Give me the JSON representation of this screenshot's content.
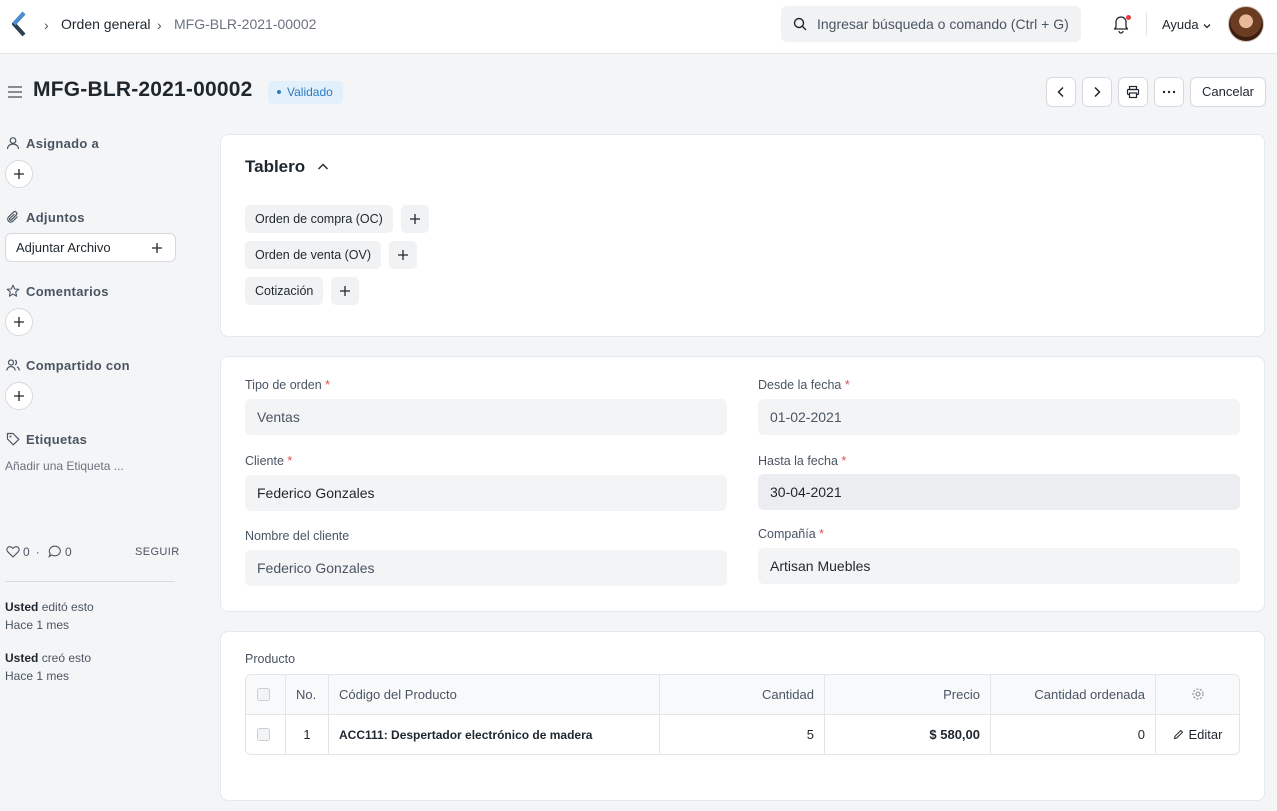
{
  "navbar": {
    "breadcrumb": [
      "Orden general",
      "MFG-BLR-2021-00002"
    ],
    "search_placeholder": "Ingresar búsqueda o comando (Ctrl + G)",
    "help_label": "Ayuda"
  },
  "header": {
    "title": "MFG-BLR-2021-00002",
    "status": "Validado",
    "status_color": "#2d7bc0",
    "cancel_label": "Cancelar"
  },
  "sidebar": {
    "assigned_label": "Asignado a",
    "attachments_label": "Adjuntos",
    "attach_button": "Adjuntar Archivo",
    "comments_label": "Comentarios",
    "shared_label": "Compartido con",
    "tags_label": "Etiquetas",
    "tag_placeholder": "Añadir una Etiqueta ...",
    "likes": "0",
    "comments_count": "0",
    "follow_label": "SEGUIR",
    "activity": [
      {
        "who": "Usted",
        "action": "editó esto",
        "when": "Hace 1 mes"
      },
      {
        "who": "Usted",
        "action": "creó esto",
        "when": "Hace 1 mes"
      }
    ]
  },
  "dashboard": {
    "title": "Tablero",
    "links": [
      "Orden de compra (OC)",
      "Orden de venta (OV)",
      "Cotización"
    ]
  },
  "form": {
    "order_type": {
      "label": "Tipo de orden",
      "value": "Ventas"
    },
    "from_date": {
      "label": "Desde la fecha",
      "value": "01-02-2021"
    },
    "customer": {
      "label": "Cliente",
      "value": "Federico Gonzales"
    },
    "to_date": {
      "label": "Hasta la fecha",
      "value": "30-04-2021"
    },
    "customer_name": {
      "label": "Nombre del cliente",
      "value": "Federico Gonzales"
    },
    "company": {
      "label": "Compañía",
      "value": "Artisan Muebles"
    }
  },
  "items": {
    "label": "Producto",
    "columns": [
      "No.",
      "Código del Producto",
      "Cantidad",
      "Precio",
      "Cantidad ordenada"
    ],
    "rows": [
      {
        "no": "1",
        "item_code": "ACC111: Despertador electrónico de madera",
        "qty": "5",
        "rate": "$ 580,00",
        "ordered_qty": "0",
        "edit_label": "Editar"
      }
    ]
  }
}
